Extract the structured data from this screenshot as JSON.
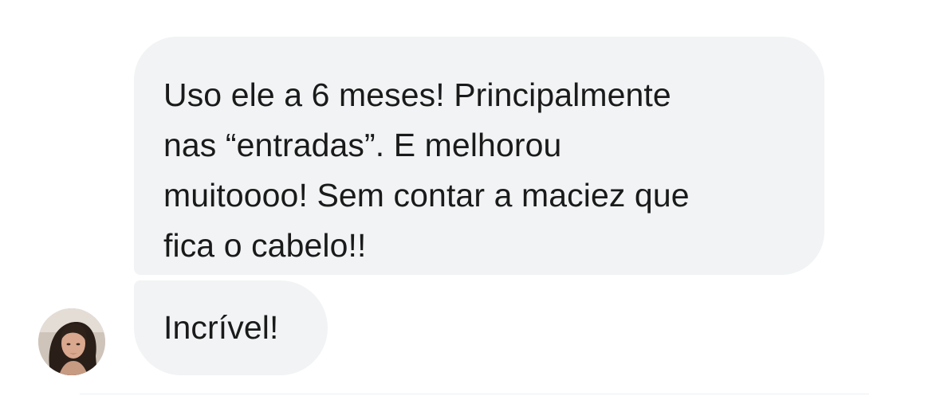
{
  "messages": [
    {
      "lines": [
        "Uso ele a 6 meses! Principalmente",
        "nas “entradas”. E melhorou",
        "muitoooo! Sem contar a maciez que",
        "fica o cabelo!!"
      ]
    },
    {
      "text": "Incrível!"
    }
  ],
  "sender": {
    "avatar_icon": "profile-photo"
  },
  "colors": {
    "bubble_background": "#f1f3f4",
    "text": "#1a1a1a",
    "page_background": "#ffffff"
  }
}
